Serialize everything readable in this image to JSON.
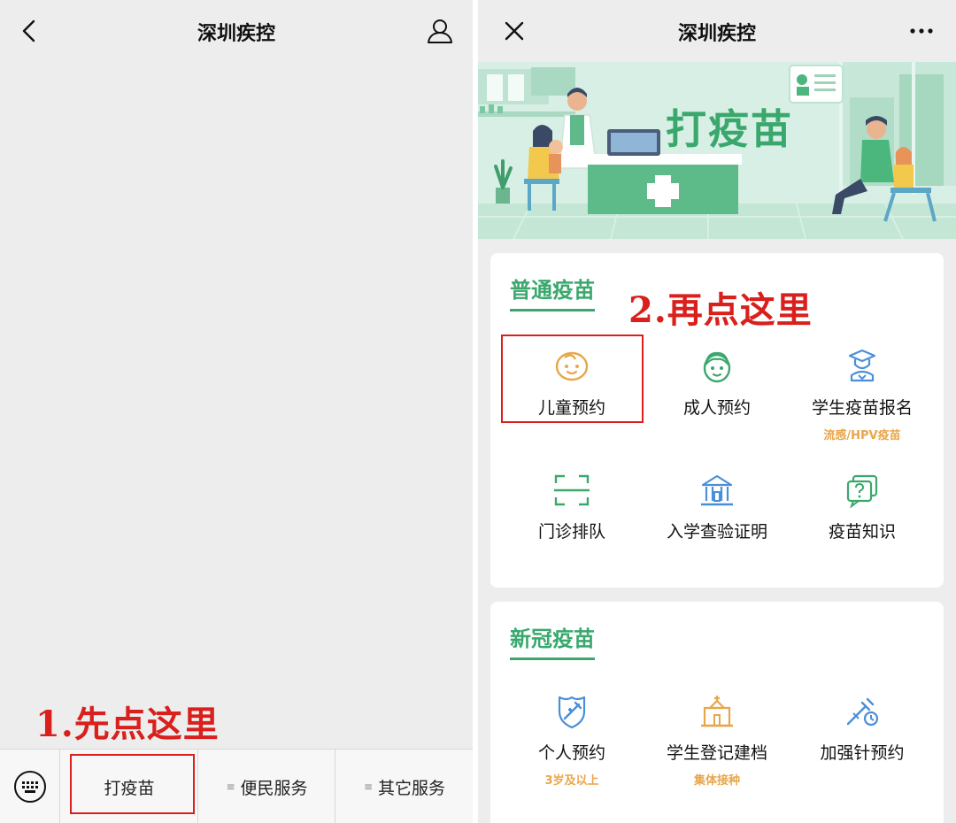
{
  "left": {
    "title": "深圳疾控",
    "hint": "1.先点这里",
    "menu": [
      "打疫苗",
      "便民服务",
      "其它服务"
    ]
  },
  "right": {
    "title": "深圳疾控",
    "banner_text": "打疫苗",
    "hint": "2.再点这里",
    "sections": [
      {
        "title": "普通疫苗",
        "items": [
          {
            "label": "儿童预约",
            "sub": "",
            "icon": "child-face-icon"
          },
          {
            "label": "成人预约",
            "sub": "",
            "icon": "adult-face-icon"
          },
          {
            "label": "学生疫苗报名",
            "sub": "流感/HPV疫苗",
            "icon": "student-icon"
          },
          {
            "label": "门诊排队",
            "sub": "",
            "icon": "scan-frame-icon"
          },
          {
            "label": "入学查验证明",
            "sub": "",
            "icon": "school-building-icon"
          },
          {
            "label": "疫苗知识",
            "sub": "",
            "icon": "question-cards-icon"
          }
        ]
      },
      {
        "title": "新冠疫苗",
        "items": [
          {
            "label": "个人预约",
            "sub": "3岁及以上",
            "icon": "shield-syringe-icon"
          },
          {
            "label": "学生登记建档",
            "sub": "集体接种",
            "icon": "school-register-icon"
          },
          {
            "label": "加强针预约",
            "sub": "",
            "icon": "booster-syringe-icon"
          }
        ]
      }
    ]
  },
  "colors": {
    "accent_green": "#3aa86d",
    "accent_orange": "#e8a64a",
    "hint_red": "#d9201c"
  }
}
